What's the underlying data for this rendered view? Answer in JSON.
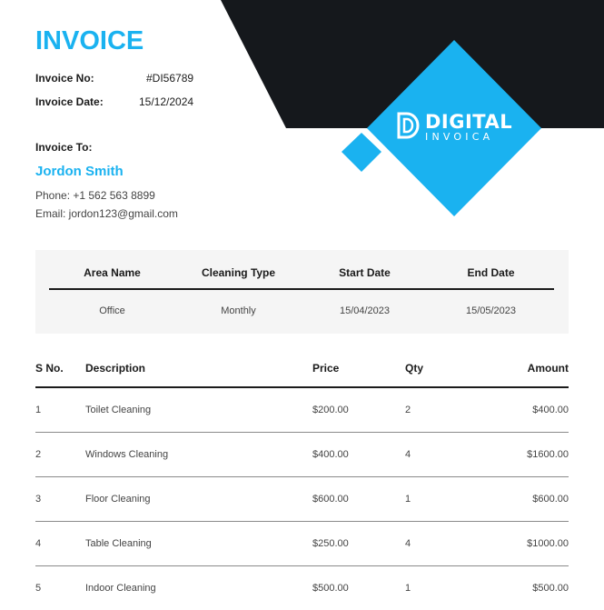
{
  "colors": {
    "accent": "#1ab2f0",
    "dark": "#15181c",
    "panel": "#f5f5f5"
  },
  "brand": {
    "line1": "DIGITAL",
    "line2": "INVOICA",
    "logo_icon": "d-logo-icon"
  },
  "title": "INVOICE",
  "meta": {
    "invoice_no_label": "Invoice No:",
    "invoice_no": "#DI56789",
    "invoice_date_label": "Invoice Date:",
    "invoice_date": "15/12/2024"
  },
  "invoice_to": {
    "label": "Invoice To:",
    "name": "Jordon Smith",
    "phone": "Phone: +1 562 563 8899",
    "email": "Email: jordon123@gmail.com"
  },
  "area_table": {
    "headers": [
      "Area Name",
      "Cleaning Type",
      "Start Date",
      "End Date"
    ],
    "row": [
      "Office",
      "Monthly",
      "15/04/2023",
      "15/05/2023"
    ]
  },
  "items_table": {
    "headers": [
      "S No.",
      "Description",
      "Price",
      "Qty",
      "Amount"
    ],
    "rows": [
      [
        "1",
        "Toilet Cleaning",
        "$200.00",
        "2",
        "$400.00"
      ],
      [
        "2",
        "Windows Cleaning",
        "$400.00",
        "4",
        "$1600.00"
      ],
      [
        "3",
        "Floor Cleaning",
        "$600.00",
        "1",
        "$600.00"
      ],
      [
        "4",
        "Table Cleaning",
        "$250.00",
        "4",
        "$1000.00"
      ],
      [
        "5",
        "Indoor Cleaning",
        "$500.00",
        "1",
        "$500.00"
      ]
    ]
  }
}
